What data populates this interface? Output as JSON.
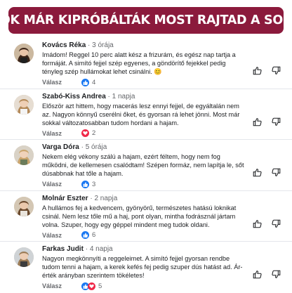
{
  "banner": {
    "title": "ŐK MÁR KIPRÓBÁLTÁK MOST RAJTAD A SOR"
  },
  "reply_label": "Válasz",
  "colors": {
    "banner": "#8b1a3c",
    "like": "#1877f2",
    "love": "#f02849"
  },
  "comments": [
    {
      "name": "Kovács Réka",
      "time": "3 órája",
      "text": "Imádom! Reggel 10 perc alatt kész a frizurám, és egész nap tartja a formáját. A simító fejjel szép egyenes, a göndörítő fejekkel pedig tényleg szép hullámokat lehet csinálni. 😊",
      "reaction": "like",
      "reaction_icon": "thumbs-up-icon",
      "count": "4"
    },
    {
      "name": "Szabó-Kiss Andrea",
      "time": "1 napja",
      "text": "Először azt hittem, hogy macerás lesz ennyi fejjel, de egyáltalán nem az. Nagyon könnyű cserélni őket, és gyorsan rá lehet jönni. Most már sokkal változatosabban tudom hordani a hajam.",
      "reaction": "love",
      "reaction_icon": "heart-icon",
      "count": "2"
    },
    {
      "name": "Varga Dóra",
      "time": "5 órája",
      "text": "Nekem elég vékony szálú a hajam, ezért féltem, hogy nem fog működni, de kellemesen csalódtam! Szépen formáz, nem lapítja le, sőt dúsabbnak hat tőle a hajam.",
      "reaction": "like",
      "reaction_icon": "thumbs-up-icon",
      "count": "3"
    },
    {
      "name": "Molnár Eszter",
      "time": "2 napja",
      "text": "A hullámos fej a kedvencem, gyönyörű, természetes hatású loknikat csinál. Nem lesz tőle mű a haj, pont olyan, mintha fodrásznál jártam volna. Szuper, hogy egy géppel mindent meg tudok oldani.",
      "reaction": "like",
      "reaction_icon": "thumbs-up-icon",
      "count": "6"
    },
    {
      "name": "Farkas Judit",
      "time": "4 napja",
      "text": "Nagyon megkönnyíti a reggeleimet. A simító fejjel gyorsan rendbe tudom tenni a hajam, a kerek kefés fej pedig szuper dús hatást ad. Ár-érték arányban szerintem tökéletes!",
      "reaction": "like+love",
      "reaction_icon": "thumbs-up-and-heart-icon",
      "count": "5"
    }
  ]
}
